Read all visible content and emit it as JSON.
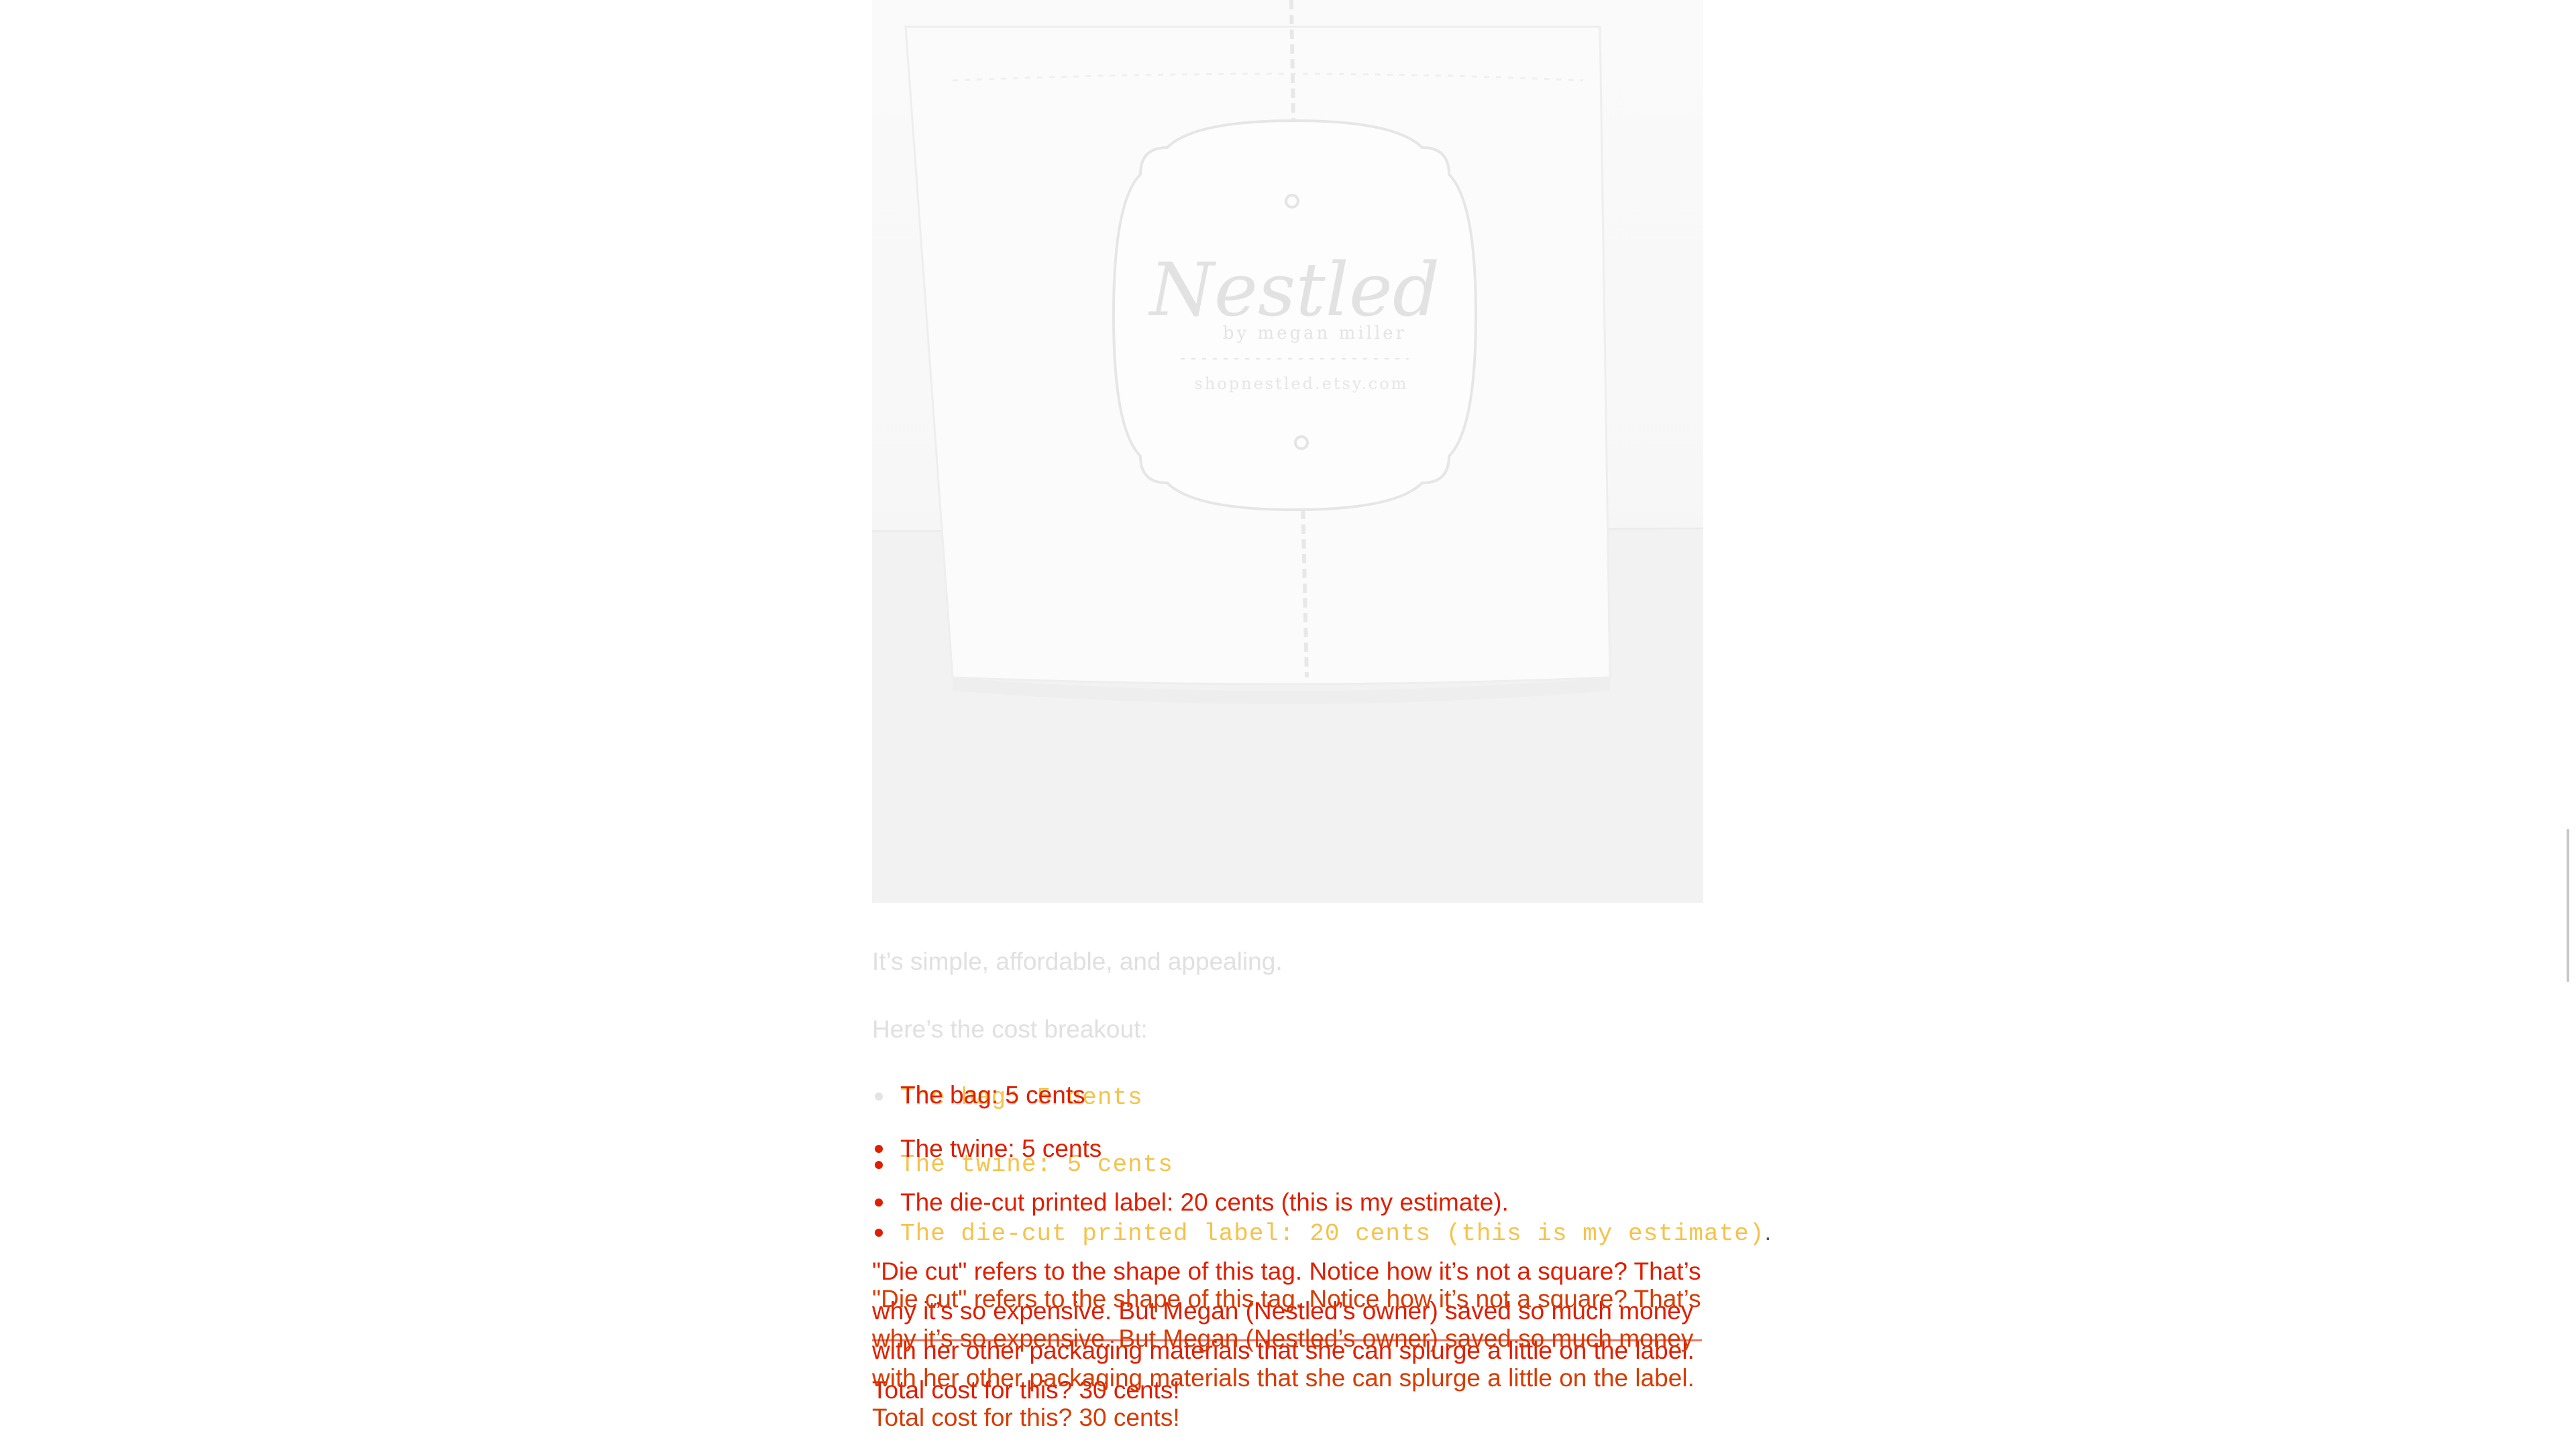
{
  "photo": {
    "tag_brand": "Nestled",
    "tag_byline": "by megan miller",
    "tag_url": "shopnestled.etsy.com"
  },
  "intro": {
    "line1": "It’s simple, affordable, and appealing.",
    "line2": "Here’s the cost breakout:"
  },
  "list_faint": [
    {
      "label": "The bag: 5 cents"
    }
  ],
  "list_red": [
    {
      "label": "The bag: 5 cents"
    },
    {
      "label": "The twine: 5 cents"
    },
    {
      "label": "The die-cut printed label: 20 cents (this is my estimate)."
    }
  ],
  "list_mono": [
    {
      "label": "The bag: 5 cents"
    },
    {
      "label": "The twine: 5 cents"
    },
    {
      "label": "The die-cut printed label: 20 cents (this is my estimate)"
    }
  ],
  "mono_trailing_period": ".",
  "paragraph_a": {
    "line1": "\"Die cut\" refers to the shape of this tag. Notice how it’s not a square? That’s",
    "line2": "why it’s so expensive. But Megan (Nestled’s owner) saved so much money",
    "line3": "with her other packaging materials that she can splurge a little on the label.",
    "total": "Total cost for this? 30 cents!"
  },
  "paragraph_b": {
    "line1": "\"Die cut\" refers to the shape of this tag. Notice how it’s not a square? That’s",
    "line2": "why it’s so expensive. But Megan (Nestled’s owner) saved so much money",
    "line3": "with her other packaging materials that she can splurge a little on the label.",
    "total": "Total cost for this? 30 cents!"
  },
  "colors": {
    "red_text": "#e01e00",
    "mono_text": "#f6c24a",
    "faint_text": "#e0e0e0",
    "background": "#ffffff"
  }
}
